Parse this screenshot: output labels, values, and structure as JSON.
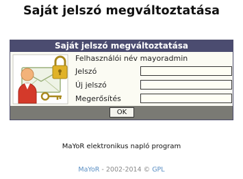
{
  "page": {
    "title": "Saját jelszó megváltoztatása"
  },
  "form": {
    "header": "Saját jelszó megváltoztatása",
    "username_label": "Felhasználói név",
    "username_value": "mayoradmin",
    "password_label": "Jelszó",
    "new_password_label": "Új jelszó",
    "confirm_label": "Megerősítés",
    "ok_label": "OK",
    "illustration_icon": "user-key-lock-icon"
  },
  "footer": {
    "credit": "MaYoR elektronikus napló program",
    "brand": "MaYoR",
    "years": " - 2002-2014 © ",
    "license": "GPL"
  },
  "colors": {
    "header_bg": "#4b4c70",
    "footer_bar_bg": "#7a7a74",
    "panel_bg": "#fbfbf3",
    "link": "#5b8fc4"
  }
}
